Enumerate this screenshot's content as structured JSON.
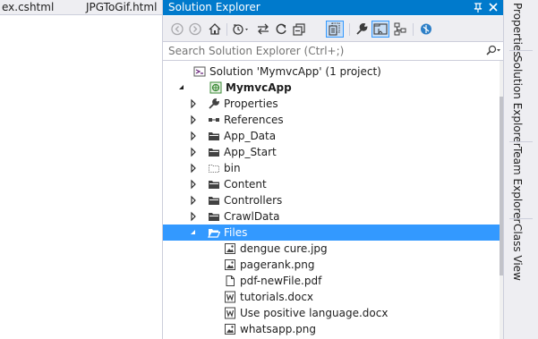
{
  "editor": {
    "tabs": [
      {
        "label": "ex.cshtml"
      },
      {
        "label": "JPGToGif.html"
      }
    ]
  },
  "solution_explorer": {
    "title": "Solution Explorer",
    "title_buttons": [
      "pin-icon",
      "close-icon"
    ],
    "toolbar": [
      "back-icon",
      "forward-icon",
      "home-icon",
      "history-icon",
      "sync-icon",
      "refresh-icon",
      "collapse-all-icon",
      "show-all-files-icon",
      "properties-wrench-icon",
      "preview-icon",
      "class-diagram-icon",
      "browser-link-icon"
    ],
    "search": {
      "placeholder": "Search Solution Explorer (Ctrl+;)",
      "value": ""
    },
    "tree": {
      "solution": "Solution 'MymvcApp' (1 project)",
      "project": "MymvcApp",
      "items": [
        {
          "label": "Properties",
          "icon": "wrench-icon"
        },
        {
          "label": "References",
          "icon": "references-icon"
        },
        {
          "label": "App_Data",
          "icon": "folder-icon"
        },
        {
          "label": "App_Start",
          "icon": "folder-icon"
        },
        {
          "label": "bin",
          "icon": "hidden-folder-icon"
        },
        {
          "label": "Content",
          "icon": "folder-icon"
        },
        {
          "label": "Controllers",
          "icon": "folder-icon"
        },
        {
          "label": "CrawlData",
          "icon": "folder-icon"
        },
        {
          "label": "Files",
          "icon": "open-folder-icon",
          "selected": true
        }
      ],
      "files": [
        {
          "label": "dengue cure.jpg",
          "icon": "image-file-icon"
        },
        {
          "label": "pagerank.png",
          "icon": "image-file-icon"
        },
        {
          "label": "pdf-newFile.pdf",
          "icon": "file-icon"
        },
        {
          "label": "tutorials.docx",
          "icon": "word-file-icon"
        },
        {
          "label": "Use positive language.docx",
          "icon": "word-file-icon"
        },
        {
          "label": "whatsapp.png",
          "icon": "image-file-icon"
        }
      ]
    }
  },
  "side_tabs": [
    {
      "label": "Properties"
    },
    {
      "label": "Solution Explorer"
    },
    {
      "label": "Team Explorer"
    },
    {
      "label": "Class View"
    }
  ],
  "colors": {
    "accent": "#007acc",
    "selection": "#3399ff",
    "chrome": "#eeeef2"
  }
}
